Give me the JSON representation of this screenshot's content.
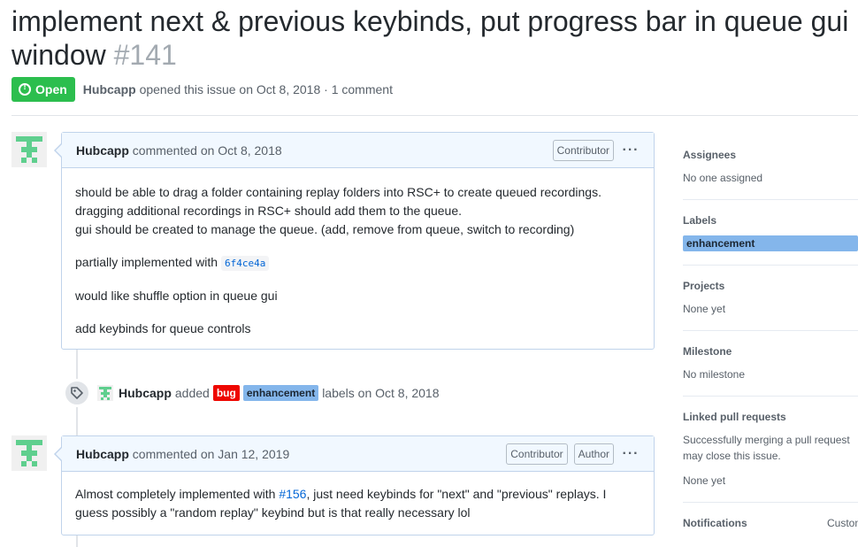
{
  "issue": {
    "title": "implement next & previous keybinds, put progress bar in queue gui window",
    "number": "#141",
    "state": "Open",
    "author": "Hubcapp",
    "opened_text": "opened this issue on Oct 8, 2018",
    "separator": "·",
    "comment_count": "1 comment"
  },
  "comments": [
    {
      "author": "Hubcapp",
      "action": "commented on Oct 8, 2018",
      "tags": [
        "Contributor"
      ],
      "menu": "···",
      "paragraphs": {
        "p1_l1": "should be able to drag a folder containing replay folders into RSC+ to create queued recordings.",
        "p1_l2": "dragging additional recordings in RSC+ should add them to the queue.",
        "p1_l3": "gui should be created to manage the queue. (add, remove from queue, switch to recording)",
        "p2_prefix": "partially implemented with",
        "p2_commit": "6f4ce4a",
        "p3": "would like shuffle option in queue gui",
        "p4": "add keybinds for queue controls"
      }
    },
    {
      "author": "Hubcapp",
      "action": "commented on Jan 12, 2019",
      "tags": [
        "Contributor",
        "Author"
      ],
      "menu": "···",
      "text_prefix": "Almost completely implemented with",
      "link": "#156",
      "text_suffix": ", just need keybinds for \"next\" and \"previous\" replays. I guess possibly a \"random replay\" keybind but is that really necessary lol"
    }
  ],
  "event": {
    "actor": "Hubcapp",
    "verb": "added",
    "labels": [
      "bug",
      "enhancement"
    ],
    "suffix": "labels on Oct 8, 2018",
    "icon": "tag-icon"
  },
  "sidebar": {
    "assignees": {
      "heading": "Assignees",
      "value": "No one assigned"
    },
    "labels": {
      "heading": "Labels",
      "value": "enhancement"
    },
    "projects": {
      "heading": "Projects",
      "value": "None yet"
    },
    "milestone": {
      "heading": "Milestone",
      "value": "No milestone"
    },
    "linked_prs": {
      "heading": "Linked pull requests",
      "desc": "Successfully merging a pull request may close this issue.",
      "value": "None yet"
    },
    "notifications": {
      "heading": "Notifications",
      "action": "Customize"
    }
  },
  "colors": {
    "open_green": "#2cbe4e",
    "label_bug": "#ee0701",
    "label_enhancement": "#84b6eb",
    "comment_header": "#f1f8ff",
    "link_blue": "#0366d6"
  }
}
